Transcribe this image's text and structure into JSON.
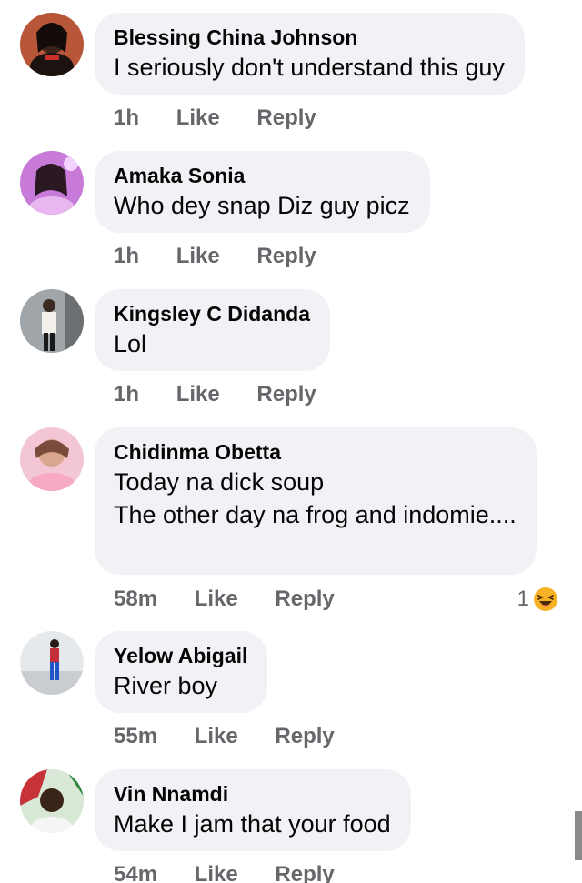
{
  "comments": [
    {
      "author": "Blessing China Johnson",
      "lines": [
        "I seriously don't understand this guy"
      ],
      "time": "1h",
      "like": "Like",
      "reply": "Reply",
      "avatar_icon": "profile-photo-icon"
    },
    {
      "author": "Amaka Sonia",
      "lines": [
        "Who dey snap Diz guy picz"
      ],
      "time": "1h",
      "like": "Like",
      "reply": "Reply",
      "avatar_icon": "profile-photo-icon"
    },
    {
      "author": "Kingsley C Didanda",
      "lines": [
        "Lol"
      ],
      "time": "1h",
      "like": "Like",
      "reply": "Reply",
      "avatar_icon": "profile-photo-icon"
    },
    {
      "author": "Chidinma Obetta",
      "lines": [
        "Today na dick soup",
        "The other day na frog and indomie...."
      ],
      "time": "58m",
      "like": "Like",
      "reply": "Reply",
      "reaction_count": "1",
      "reaction_icon": "laughing-emoji-icon",
      "avatar_icon": "profile-photo-icon"
    },
    {
      "author": "Yelow Abigail",
      "lines": [
        "River boy"
      ],
      "time": "55m",
      "like": "Like",
      "reply": "Reply",
      "avatar_icon": "profile-photo-icon"
    },
    {
      "author": "Vin Nnamdi",
      "lines": [
        "Make I jam that your food"
      ],
      "time": "54m",
      "like": "Like",
      "reply": "Reply",
      "avatar_icon": "profile-photo-icon"
    }
  ],
  "colors": {
    "bubble": "#f0f2f5",
    "meta_text": "#65676b",
    "reaction_face": "#f7b125"
  }
}
